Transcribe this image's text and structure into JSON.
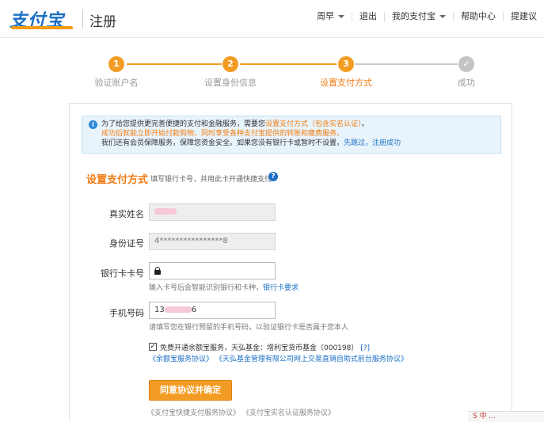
{
  "header": {
    "logo_text": "支付宝",
    "page_title": "注册",
    "nav": {
      "user": "周早",
      "logout": "退出",
      "my_alipay": "我的支付宝",
      "help": "帮助中心",
      "suggest": "提建议"
    }
  },
  "steps": [
    {
      "num": "1",
      "label": "验证账户名",
      "state": "done"
    },
    {
      "num": "2",
      "label": "设置身份信息",
      "state": "done"
    },
    {
      "num": "3",
      "label": "设置支付方式",
      "state": "current"
    },
    {
      "num": "✓",
      "label": "成功",
      "state": "pending"
    }
  ],
  "colors": {
    "accent": "#f39c24",
    "link": "#1a6fc4",
    "pending": "#cccccc"
  },
  "notice": {
    "icon": "i",
    "line1_prefix": "为了给您提供更完善便捷的支付和金融服务，需要您",
    "line1_highlight": "设置支付方式（包含实名认证）",
    "line1_suffix": "。",
    "line2": "成功后就能立即开始付款购物，同时享受各种支付宝提供的转账和缴费服务。",
    "line3_prefix": "我们还有会员保障服务，保障您资金安全。如果您没有银行卡或暂时不设置，",
    "line3_link": "先跳过，注册成功"
  },
  "form": {
    "section_title": "设置支付方式",
    "section_sub": "填写银行卡号，并用此卡开通快捷支付",
    "help_icon": "?",
    "name_label": "真实姓名",
    "id_label": "身份证号",
    "id_value": "4****************8",
    "card_label": "银行卡卡号",
    "card_hint_prefix": "输入卡号后会智能识别银行和卡种，",
    "card_hint_link": "银行卡要求",
    "phone_label": "手机号码",
    "phone_prefix": "13",
    "phone_suffix": "6",
    "phone_hint": "请填写您在银行预留的手机号码，以验证银行卡是否属于您本人",
    "yuebao_check": "免费开通余额宝服务，天弘基金：增利宝货币基金（000198）",
    "yuebao_help": "[?]",
    "link1": "《余额宝服务协议》",
    "link2": "《天弘基金管理有限公司网上交易直销自助式前台服务协议》",
    "submit": "同意协议并确定",
    "bottom_link1": "《支付宝快捷支付服务协议》",
    "bottom_link2": "《支付宝实名认证服务协议》"
  },
  "corner": "S 中 ..."
}
